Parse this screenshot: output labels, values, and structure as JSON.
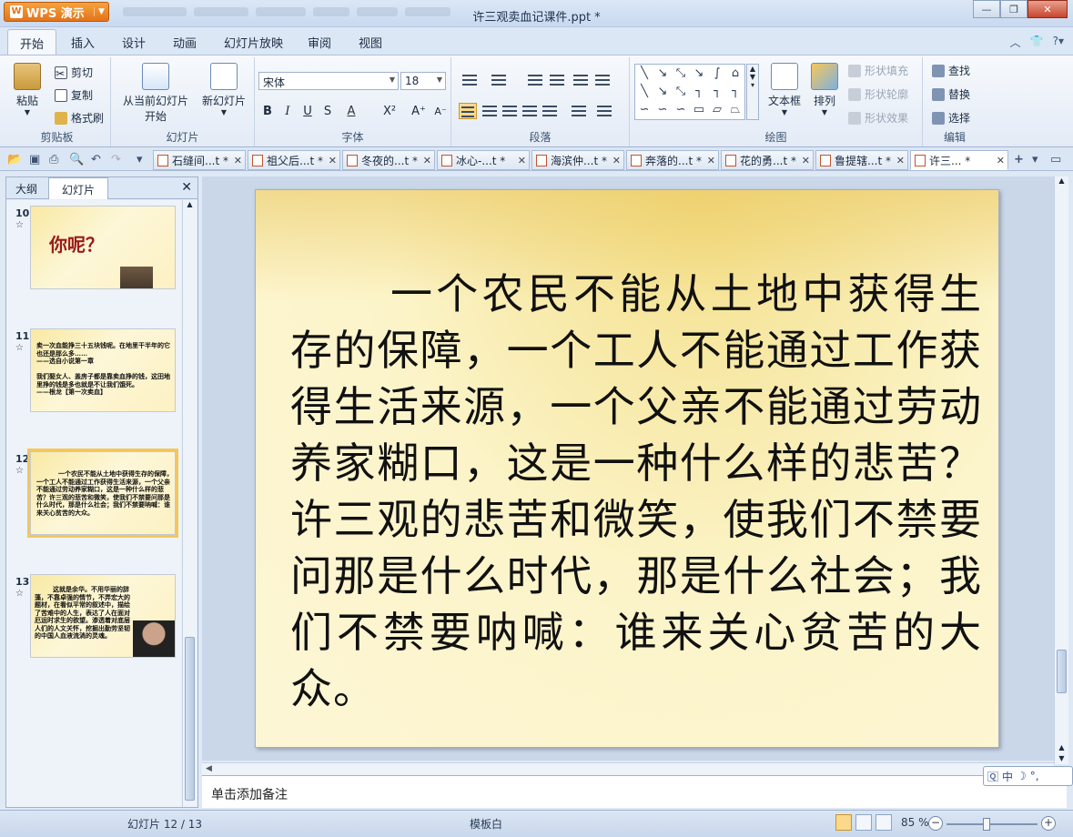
{
  "app": {
    "name": "WPS 演示",
    "doc_title": "许三观卖血记课件.ppt *"
  },
  "menu": {
    "tabs": [
      "开始",
      "插入",
      "设计",
      "动画",
      "幻灯片放映",
      "审阅",
      "视图"
    ]
  },
  "ribbon": {
    "clipboard": {
      "label": "剪贴板",
      "paste": "粘贴",
      "cut": "剪切",
      "copy": "复制",
      "format_painter": "格式刷"
    },
    "slides": {
      "label": "幻灯片",
      "from_current_line1": "从当前幻灯片",
      "from_current_line2": "开始",
      "new_slide": "新幻灯片"
    },
    "font": {
      "label": "字体",
      "family": "宋体",
      "size": "18"
    },
    "paragraph": {
      "label": "段落"
    },
    "drawing": {
      "label": "绘图",
      "textbox": "文本框",
      "arrange": "排列",
      "shape_fill": "形状填充",
      "shape_outline": "形状轮廓",
      "shape_effect": "形状效果"
    },
    "edit": {
      "label": "编辑",
      "find": "查找",
      "replace": "替换",
      "select": "选择"
    }
  },
  "doc_tabs": [
    "石缝间...t *",
    "祖父后...t *",
    "冬夜的...t *",
    "冰心-...t *",
    "海滨仲...t *",
    "奔落的...t *",
    "花的勇...t *",
    "鲁提辖...t *",
    "许三... *"
  ],
  "left_pane": {
    "tabs": [
      "大纲",
      "幻灯片"
    ],
    "thumbnails": [
      {
        "num": "10",
        "star": "☆",
        "text": "你呢？"
      },
      {
        "num": "11",
        "star": "☆",
        "text": "卖一次血能挣三十五块钱呢。在地里干半年的它也还是那么多……\n——选自小说第一章\n\n我们娶女人、盖房子都是靠卖血挣的钱，这田地里挣的钱是多也就是不让我们饿死。\n——根龙【第一次卖血】"
      },
      {
        "num": "12",
        "star": "☆",
        "text": "一个农民不能从土地中获得生存的保障，一个工人不能通过工作获得生活来源，一个父亲不能通过劳动养家糊口，这是一种什么样的悲苦？许三观的悲苦和微笑，使我们不禁要问那是什么时代，那是什么社会；我们不禁要呐喊：谁来关心贫苦的大众。"
      },
      {
        "num": "13",
        "star": "☆",
        "text": "这就是余华。不用华丽的辞藻，不靠卓强的情节，不弄宏大的题材，在看似平常的叙述中，描绘了苦难中的人生，表达了人在面对厄运时求生的欲望。渗透着对底层人们的人文关怀，挖掘出勤劳坚韧的中国人血液流淌的灵魂。"
      }
    ]
  },
  "slide": {
    "text": "一个农民不能从土地中获得生存的保障，一个工人不能通过工作获得生活来源，一个父亲不能通过劳动养家糊口，这是一种什么样的悲苦？许三观的悲苦和微笑，使我们不禁要问那是什么时代，那是什么社会；我们不禁要呐喊：谁来关心贫苦的大众。"
  },
  "notes_placeholder": "单击添加备注",
  "status": {
    "slide_counter": "幻灯片 12 / 13",
    "template": "模板白",
    "zoom": "85 %"
  },
  "ime": {
    "mode": "中"
  }
}
